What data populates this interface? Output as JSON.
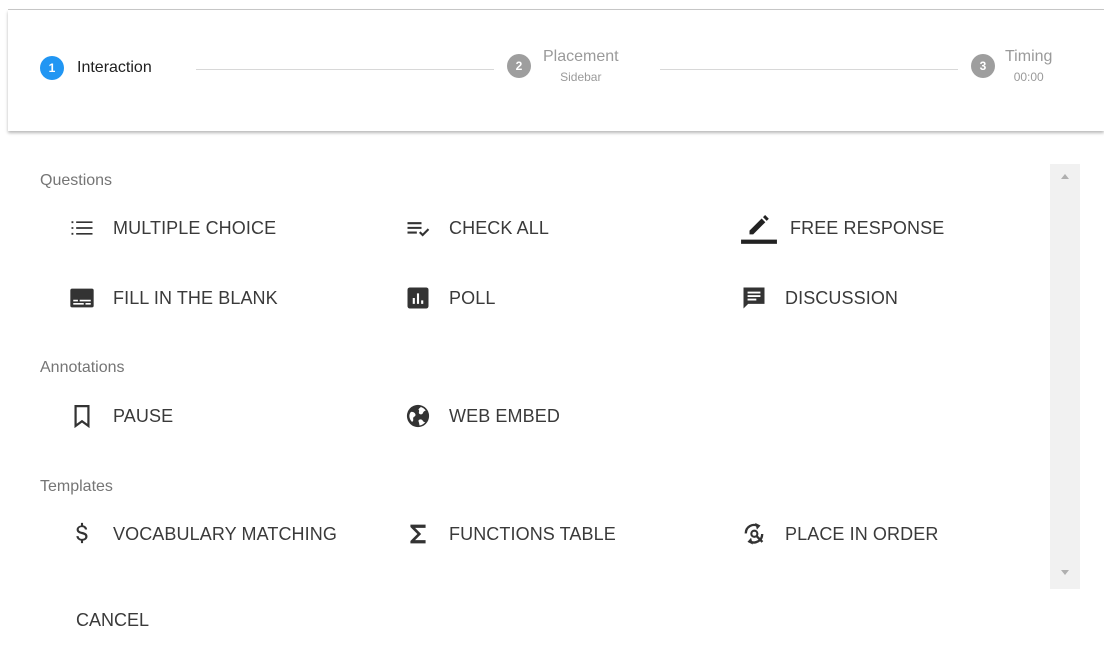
{
  "stepper": {
    "steps": [
      {
        "number": "1",
        "label": "Interaction",
        "sub": ""
      },
      {
        "number": "2",
        "label": "Placement",
        "sub": "Sidebar"
      },
      {
        "number": "3",
        "label": "Timing",
        "sub": "00:00"
      }
    ]
  },
  "sections": [
    {
      "title": "Questions",
      "items": [
        {
          "label": "MULTIPLE CHOICE",
          "icon": "list-icon"
        },
        {
          "label": "CHECK ALL",
          "icon": "checklist-icon"
        },
        {
          "label": "FREE RESPONSE",
          "icon": "pencil-icon"
        },
        {
          "label": "FILL IN THE BLANK",
          "icon": "subtitles-icon"
        },
        {
          "label": "POLL",
          "icon": "bar-chart-icon"
        },
        {
          "label": "DISCUSSION",
          "icon": "chat-icon"
        }
      ]
    },
    {
      "title": "Annotations",
      "items": [
        {
          "label": "PAUSE",
          "icon": "bookmark-icon"
        },
        {
          "label": "WEB EMBED",
          "icon": "globe-icon"
        }
      ]
    },
    {
      "title": "Templates",
      "items": [
        {
          "label": "VOCABULARY MATCHING",
          "icon": "dollar-icon"
        },
        {
          "label": "FUNCTIONS TABLE",
          "icon": "sigma-icon"
        },
        {
          "label": "PLACE IN ORDER",
          "icon": "reorder-icon"
        }
      ]
    }
  ],
  "cancel_label": "CANCEL",
  "colors": {
    "active_step": "#2196f3",
    "inactive_step": "#9e9e9e",
    "icon": "#333333"
  }
}
